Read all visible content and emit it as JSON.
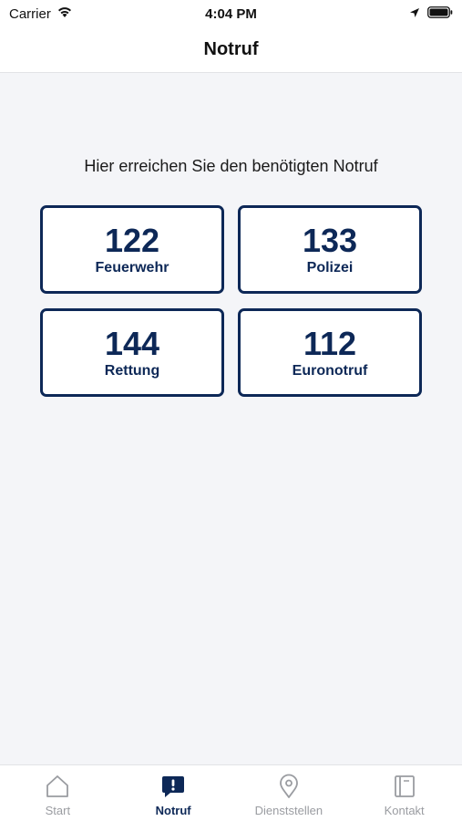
{
  "status_bar": {
    "carrier": "Carrier",
    "time": "4:04 PM"
  },
  "nav": {
    "title": "Notruf"
  },
  "main": {
    "intro": "Hier erreichen Sie den benötigten Notruf",
    "cards": [
      {
        "number": "122",
        "label": "Feuerwehr"
      },
      {
        "number": "133",
        "label": "Polizei"
      },
      {
        "number": "144",
        "label": "Rettung"
      },
      {
        "number": "112",
        "label": "Euronotruf"
      }
    ]
  },
  "tabs": [
    {
      "label": "Start",
      "icon": "home-icon",
      "active": false
    },
    {
      "label": "Notruf",
      "icon": "alert-bubble-icon",
      "active": true
    },
    {
      "label": "Dienststellen",
      "icon": "location-pin-icon",
      "active": false
    },
    {
      "label": "Kontakt",
      "icon": "contact-book-icon",
      "active": false
    }
  ],
  "colors": {
    "brand": "#0d2857",
    "background": "#f4f5f8",
    "inactive": "#9a9ca1"
  }
}
